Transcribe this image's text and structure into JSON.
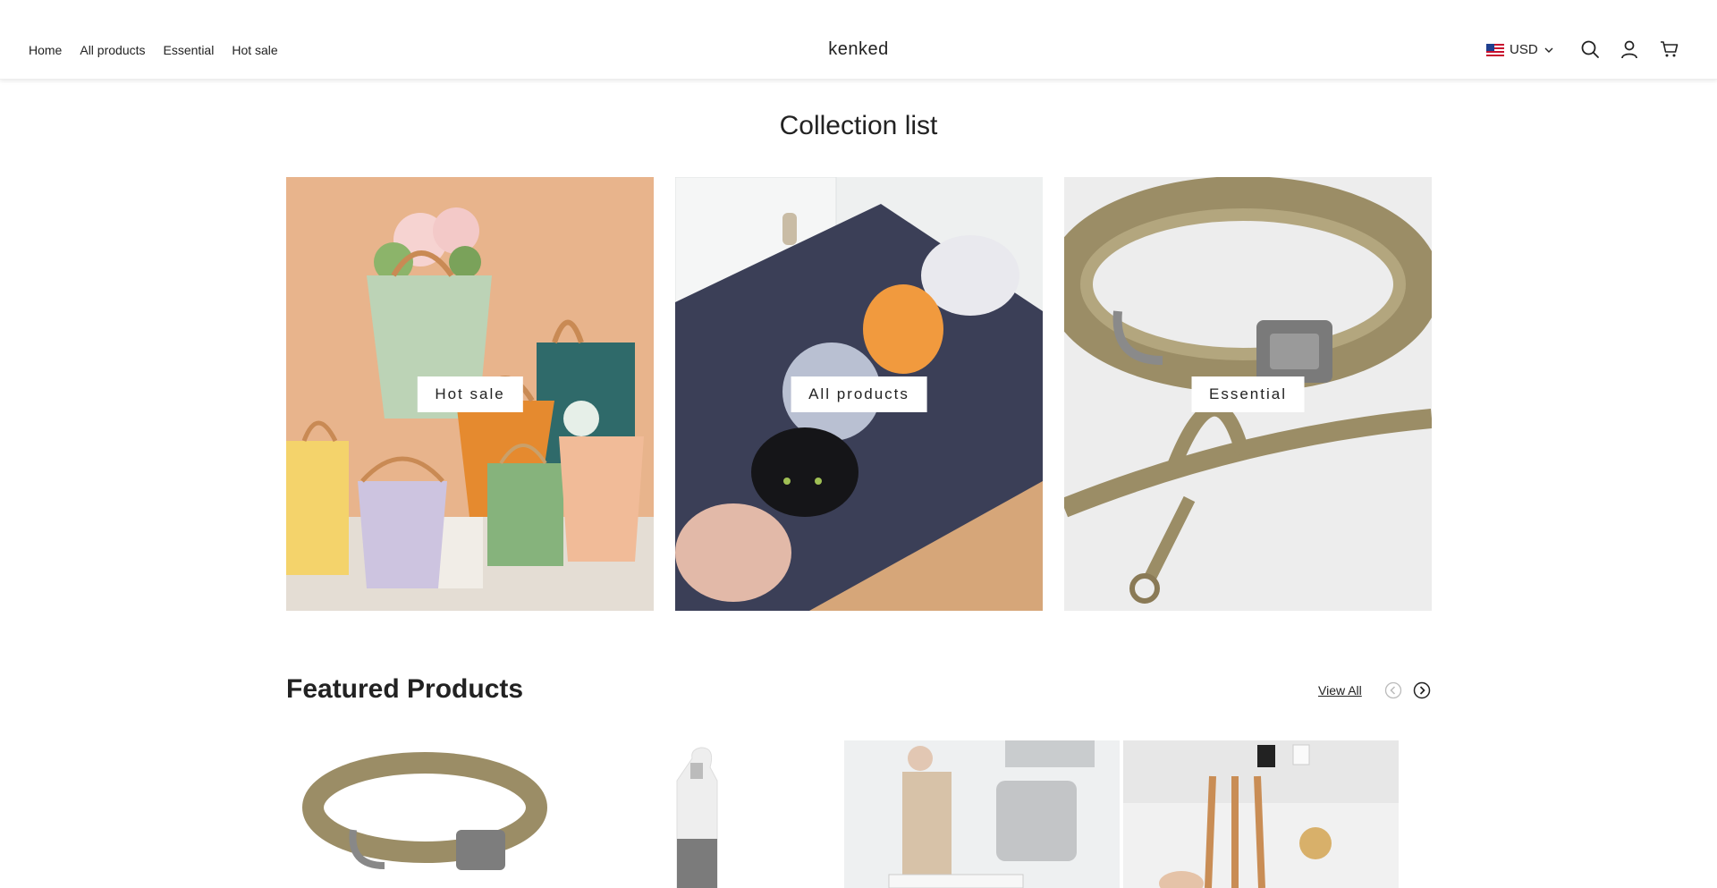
{
  "header": {
    "nav": [
      {
        "label": "Home"
      },
      {
        "label": "All products"
      },
      {
        "label": "Essential"
      },
      {
        "label": "Hot sale"
      }
    ],
    "logo": "kenked",
    "currency": "USD"
  },
  "collection_list": {
    "title": "Collection list",
    "items": [
      {
        "label": "Hot sale"
      },
      {
        "label": "All products"
      },
      {
        "label": "Essential"
      }
    ]
  },
  "featured": {
    "title": "Featured Products",
    "view_all": "View All"
  }
}
